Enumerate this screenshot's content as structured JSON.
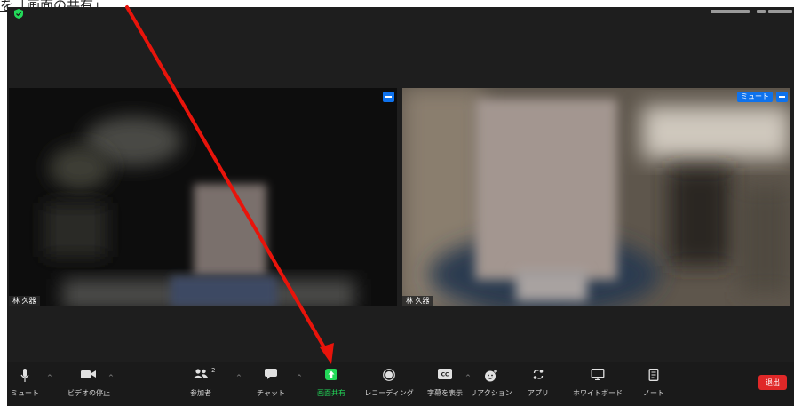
{
  "top_note": "を「画面の共有」",
  "participants_count": "2",
  "video_left": {
    "name": "林 久器"
  },
  "video_right": {
    "name": "林 久器",
    "mute_badge": "ミュート"
  },
  "toolbar": {
    "mute": "ミュート",
    "stop_video": "ビデオの停止",
    "participants": "参加者",
    "chat": "チャット",
    "share_screen": "画面共有",
    "recording": "レコーディング",
    "captions": "字幕を表示",
    "reactions": "リアクション",
    "apps": "アプリ",
    "whiteboard": "ホワイトボード",
    "notes": "ノート",
    "end": "退出"
  },
  "colors": {
    "share_green": "#23d959",
    "end_red": "#e02828",
    "accent_blue": "#0e72ed",
    "arrow_red": "#e8140b"
  }
}
